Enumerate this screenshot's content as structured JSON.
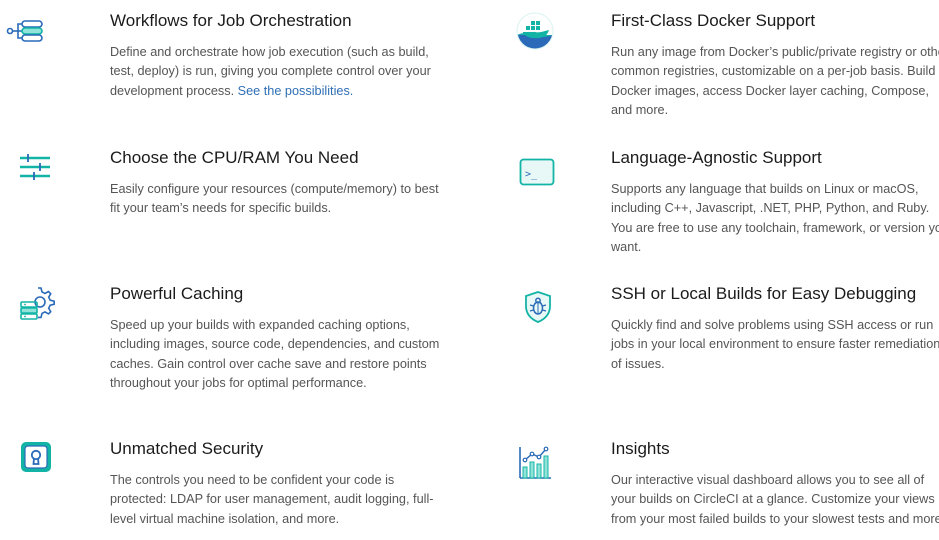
{
  "features": [
    {
      "title": "Workflows for Job Orchestration",
      "description": "Define and orchestrate how job execution (such as build, test, deploy) is run, giving you complete control over your development process.",
      "link_text": "See the possibilities.",
      "icon": "workflow-icon"
    },
    {
      "title": "Choose the CPU/RAM You Need",
      "description": "Easily configure your resources (compute/memory) to best fit your team’s needs for specific builds.",
      "icon": "sliders-icon"
    },
    {
      "title": "Powerful Caching",
      "description": "Speed up your builds with expanded caching options, including images, source code, dependencies, and custom caches. Gain control over cache save and restore points throughout your jobs for optimal performance.",
      "icon": "cache-gear-icon"
    },
    {
      "title": "Unmatched Security",
      "description": "The controls you need to be confident your code is protected: LDAP for user management, audit logging, full-level virtual machine isolation, and more.",
      "icon": "lock-icon"
    },
    {
      "title": "First-Class Docker Support",
      "description": "Run any image from Docker’s public/private registry or other common registries, customizable on a per-job basis. Build Docker images, access Docker layer caching, Compose, and more.",
      "icon": "docker-whale-icon"
    },
    {
      "title": "Language-Agnostic Support",
      "description": "Supports any language that builds on Linux or macOS, including C++, Javascript, .NET, PHP, Python, and Ruby. You are free to use any toolchain, framework, or version you want.",
      "icon": "terminal-icon",
      "icon_glyph": ">_"
    },
    {
      "title": "SSH or Local Builds for Easy Debugging",
      "description": "Quickly find and solve problems using SSH access or run jobs in your local environment to ensure faster remediation of issues.",
      "icon": "bug-shield-icon"
    },
    {
      "title": "Insights",
      "description": "Our interactive visual dashboard allows you to see all of your builds on CircleCI at a glance. Customize your views from your most failed builds to your slowest tests and more.",
      "icon": "chart-icon"
    }
  ],
  "colors": {
    "accent_teal": "#13b4a6",
    "accent_blue": "#2a6ab8",
    "link": "#2f6fb5",
    "text": "#555555",
    "heading": "#1b1b1b"
  }
}
